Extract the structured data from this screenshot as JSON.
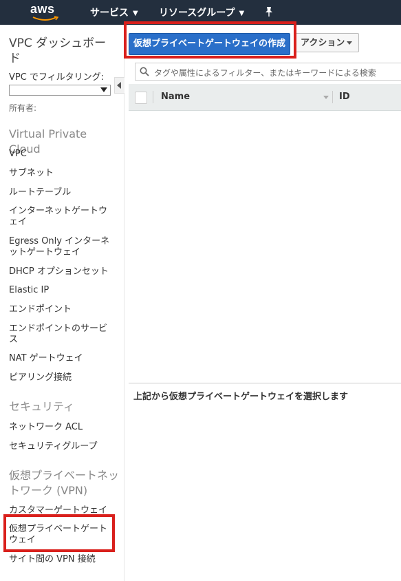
{
  "topnav": {
    "logo": "aws",
    "services": "サービス",
    "resource_groups": "リソースグループ",
    "pin_icon": "pin-icon"
  },
  "sidebar": {
    "title": "VPC ダッシュボード",
    "filter_label": "VPC でフィルタリング:",
    "owner_label": "所有者:",
    "sections": [
      {
        "title": "Virtual Private Cloud",
        "items": [
          "VPC",
          "サブネット",
          "ルートテーブル",
          "インターネットゲートウェイ",
          "Egress Only インターネットゲートウェイ",
          "DHCP オプションセット",
          "Elastic IP",
          "エンドポイント",
          "エンドポイントのサービス",
          "NAT ゲートウェイ",
          "ピアリング接続"
        ]
      },
      {
        "title": "セキュリティ",
        "items": [
          "ネットワーク ACL",
          "セキュリティグループ"
        ]
      },
      {
        "title": "仮想プライベートネットワーク (VPN)",
        "items": [
          "カスタマーゲートウェイ",
          "仮想プライベートゲートウェイ",
          "サイト間の VPN 接続"
        ]
      }
    ]
  },
  "toolbar": {
    "create_button": "仮想プライベートゲートウェイの作成",
    "actions_button": "アクション"
  },
  "search": {
    "placeholder": "タグや属性によるフィルター、またはキーワードによる検索"
  },
  "table": {
    "columns": [
      "Name",
      "ID"
    ]
  },
  "detail": {
    "message": "上記から仮想プライベートゲートウェイを選択します"
  },
  "colors": {
    "topbar": "#232f3e",
    "primary_button": "#2a6fc9",
    "highlight": "#d9201c"
  }
}
